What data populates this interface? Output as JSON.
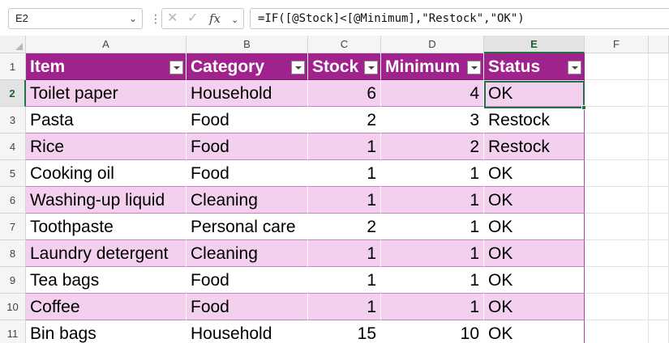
{
  "name_box": {
    "value": "E2"
  },
  "formula": {
    "cancel_icon": "cancel-x-icon",
    "enter_icon": "check-icon",
    "fx_label": "fx",
    "value": "=IF([@Stock]<[@Minimum],\"Restock\",\"OK\")"
  },
  "columns": [
    "A",
    "B",
    "C",
    "D",
    "E",
    "F"
  ],
  "rows": [
    "1",
    "2",
    "3",
    "4",
    "5",
    "6",
    "7",
    "8",
    "9",
    "10",
    "11"
  ],
  "selected": {
    "column": "E",
    "row": "2"
  },
  "table": {
    "headers": [
      "Item",
      "Category",
      "Stock",
      "Minimum",
      "Status"
    ],
    "rows": [
      [
        "Toilet paper",
        "Household",
        "6",
        "4",
        "OK"
      ],
      [
        "Pasta",
        "Food",
        "2",
        "3",
        "Restock"
      ],
      [
        "Rice",
        "Food",
        "1",
        "2",
        "Restock"
      ],
      [
        "Cooking oil",
        "Food",
        "1",
        "1",
        "OK"
      ],
      [
        "Washing-up liquid",
        "Cleaning",
        "1",
        "1",
        "OK"
      ],
      [
        "Toothpaste",
        "Personal care",
        "2",
        "1",
        "OK"
      ],
      [
        "Laundry detergent",
        "Cleaning",
        "1",
        "1",
        "OK"
      ],
      [
        "Tea bags",
        "Food",
        "1",
        "1",
        "OK"
      ],
      [
        "Coffee",
        "Food",
        "1",
        "1",
        "OK"
      ],
      [
        "Bin bags",
        "Household",
        "15",
        "10",
        "OK"
      ]
    ]
  },
  "colors": {
    "table_header": "#a0228c",
    "band": "#f2d0ee",
    "selection": "#217346"
  }
}
